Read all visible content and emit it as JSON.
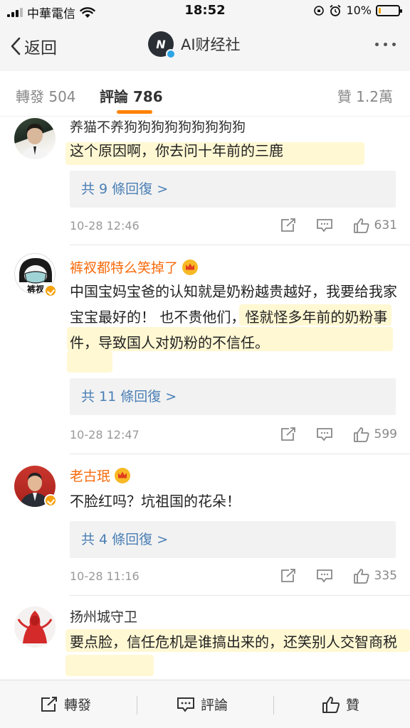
{
  "status_bar": {
    "carrier": "中華電信",
    "time": "18:52",
    "battery": "10%",
    "battery_level": 0.1
  },
  "nav": {
    "back_label": "返回",
    "title": "AI财经社",
    "avatar_text": "N"
  },
  "tabs": {
    "repost": "轉發 504",
    "comments": "評論 786",
    "likes": "贊 1.2萬"
  },
  "comments": [
    {
      "user": "养猫不养狗狗狗狗狗狗狗狗狗",
      "text": "这个原因啊，你去问十年前的三鹿",
      "replies": "共 9 條回復 >",
      "date": "10-28 12:46",
      "likes": "631"
    },
    {
      "user": "裤衩都特么笑掉了",
      "text": "中国宝妈宝爸的认知就是奶粉越贵越好，我要给我家宝宝最好的！ 也不贵他们，怪就怪多年前的奶粉事件，导致国人对奶粉的不信任。",
      "replies": "共 11 條回復 >",
      "date": "10-28 12:47",
      "likes": "599",
      "avatar_text": "裤衩"
    },
    {
      "user": "老古珉",
      "text": "不脸红吗？坑祖国的花朵！",
      "replies": "共 4 條回復 >",
      "date": "10-28 11:16",
      "likes": "335"
    },
    {
      "user": "扬州城守卫",
      "text": "要点脸，信任危机是谁搞出来的，还笑别人交智商税"
    }
  ],
  "bottom_bar": {
    "repost": "轉發",
    "comment": "評論",
    "like": "贊"
  },
  "colors": {
    "vip_name": "#f86b0d",
    "tab_accent": "#ff8200",
    "reply_link": "#4a7fb5",
    "highlight": "#ffeb82"
  }
}
